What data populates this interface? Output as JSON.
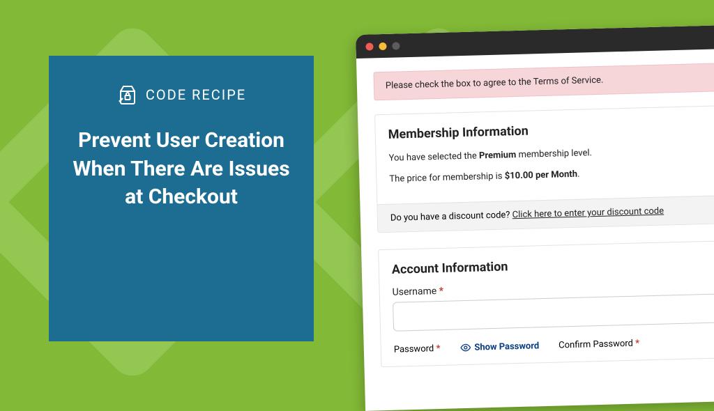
{
  "brand": {
    "logo_text": "CODE RECIPE",
    "headline": "Prevent User Creation When There Are Issues at Checkout"
  },
  "alert": {
    "text": "Please check the box to agree to the Terms of Service."
  },
  "membership": {
    "heading": "Membership Information",
    "selected_prefix": "You have selected the ",
    "selected_level": "Premium",
    "selected_suffix": " membership level.",
    "price_prefix": "The price for membership is ",
    "price_value": "$10.00 per Month",
    "price_suffix": ".",
    "discount_q": "Do you have a discount code? ",
    "discount_link": "Click here to enter your discount code"
  },
  "account": {
    "heading": "Account Information",
    "username_label": "Username",
    "password_label": "Password",
    "confirm_label": "Confirm Password",
    "show_password": "Show Password",
    "required_mark": "*",
    "username_value": ""
  }
}
